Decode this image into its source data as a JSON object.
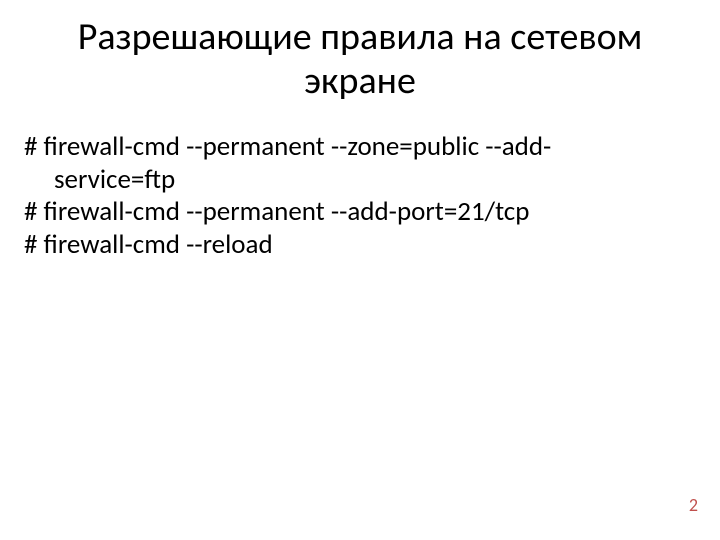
{
  "title": "Разрешающие правила на сетевом экране",
  "body": {
    "l1a": "# firewall-cmd --permanent --zone=public --add-",
    "l1b": "service=ftp",
    "l2": "# firewall-cmd  --permanent  --add-port=21/tcp",
    "l3": "# firewall-cmd --reload"
  },
  "page": "2"
}
